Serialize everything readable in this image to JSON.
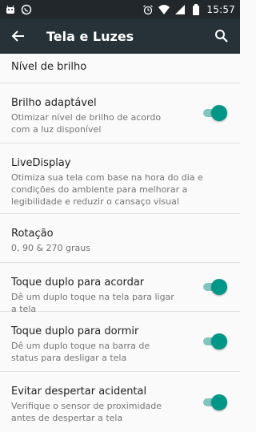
{
  "status_bar": {
    "time": "15:57",
    "left_icons": [
      "android-icon",
      "whatsapp-icon"
    ],
    "right_icons": [
      "alarm-icon",
      "wifi-icon",
      "signal-icon",
      "battery-icon"
    ]
  },
  "app_bar": {
    "title": "Tela e Luzes",
    "back_icon": "back-arrow-icon",
    "search_icon": "search-icon",
    "background": "#263238"
  },
  "settings": [
    {
      "title": "Nível de brilho"
    },
    {
      "title": "Brilho adaptável",
      "subtitle": "Otimizar nível de brilho de acordo com a luz disponível",
      "toggle": true
    },
    {
      "title": "LiveDisplay",
      "subtitle": "Otimiza sua tela com base na hora do dia e condições do ambiente para melhorar a legibilidade e reduzir o cansaço visual"
    },
    {
      "title": "Rotação",
      "subtitle": "0, 90 & 270 graus"
    },
    {
      "title": "Toque duplo para acordar",
      "subtitle": "Dê um duplo toque na tela para ligar a tela",
      "toggle": true
    },
    {
      "title": "Toque duplo para dormir",
      "subtitle": "Dê um duplo toque na barra de status para desligar a tela",
      "toggle": true
    },
    {
      "title": "Evitar despertar acidental",
      "subtitle": "Verifique o sensor de proximidade antes de despertar a tela",
      "toggle": true
    }
  ],
  "colors": {
    "accent": "#009688",
    "track": "#7fc6bd",
    "status_bar": "#21272b"
  }
}
